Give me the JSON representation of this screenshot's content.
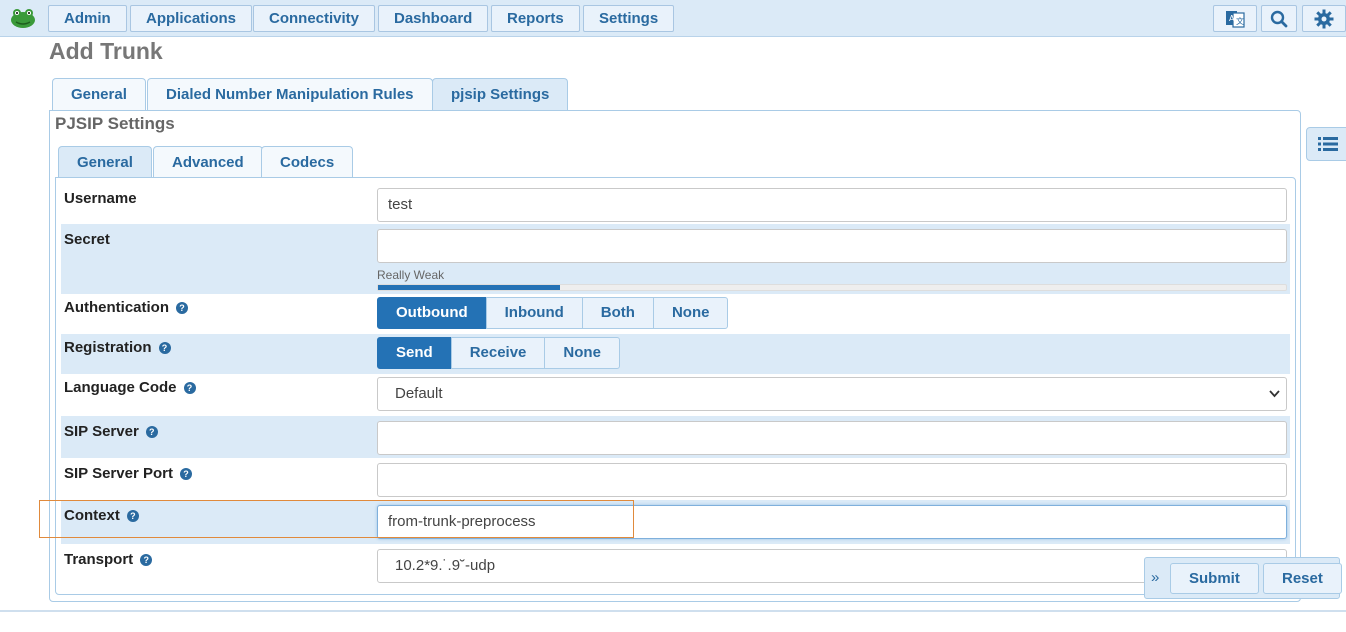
{
  "nav": {
    "items": [
      "Admin",
      "Applications",
      "Connectivity",
      "Dashboard",
      "Reports",
      "Settings"
    ],
    "icons": [
      "language-icon",
      "search-icon",
      "gear-icon"
    ]
  },
  "page": {
    "title": "Add Trunk"
  },
  "tabs": {
    "general": "General",
    "dialed": "Dialed Number Manipulation Rules",
    "pjsip": "pjsip Settings"
  },
  "pjsip": {
    "title": "PJSIP Settings",
    "subtabs": {
      "general": "General",
      "advanced": "Advanced",
      "codecs": "Codecs"
    }
  },
  "form": {
    "username": {
      "label": "Username",
      "value": "test"
    },
    "secret": {
      "label": "Secret",
      "value": "",
      "strength_text": "Really Weak",
      "strength_level": 0.2
    },
    "authentication": {
      "label": "Authentication",
      "options": [
        "Outbound",
        "Inbound",
        "Both",
        "None"
      ],
      "selected": "Outbound"
    },
    "registration": {
      "label": "Registration",
      "options": [
        "Send",
        "Receive",
        "None"
      ],
      "selected": "Send"
    },
    "language": {
      "label": "Language Code",
      "value": "Default"
    },
    "sip_server": {
      "label": "SIP Server",
      "value": ""
    },
    "sip_server_port": {
      "label": "SIP Server Port",
      "value": ""
    },
    "context": {
      "label": "Context",
      "value": "from-trunk-preprocess"
    },
    "transport": {
      "label": "Transport",
      "value": "10.2*9.˙.9˘-udp"
    }
  },
  "actions": {
    "submit": "Submit",
    "reset": "Reset"
  },
  "colors": {
    "accent": "#2472b5",
    "nav_bg": "#dbeaf7",
    "highlight": "#e08a3c"
  }
}
